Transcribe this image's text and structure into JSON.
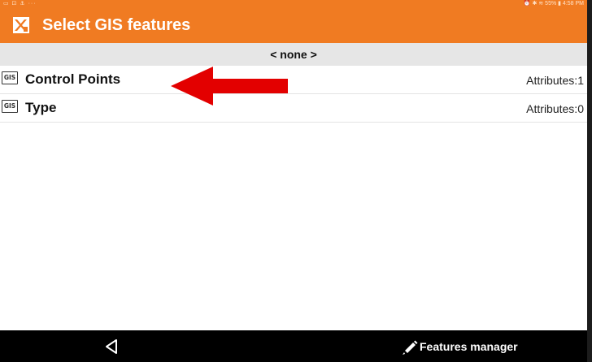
{
  "status_bar": {
    "left_icons": "▭ ⊡ ⚓ ···",
    "right_text": "⏰ ✱ ≋ 55% ▮ 4:58 PM"
  },
  "app_bar": {
    "title": "Select GIS features",
    "logo_icon": "app-logo-icon"
  },
  "none_option": "< none >",
  "features": [
    {
      "icon_text": "GIS",
      "name": "Control Points",
      "attributes": "Attributes:1"
    },
    {
      "icon_text": "GIS",
      "name": "Type",
      "attributes": "Attributes:0"
    }
  ],
  "annotation": {
    "arrow_color": "#e30000"
  },
  "nav_bar": {
    "back_icon": "back-triangle-icon",
    "features_manager_label": "Features manager",
    "features_manager_icon": "pencil-icon"
  },
  "colors": {
    "accent": "#f07b22",
    "list_header_bg": "#e6e6e6",
    "nav_bg": "#000000"
  }
}
